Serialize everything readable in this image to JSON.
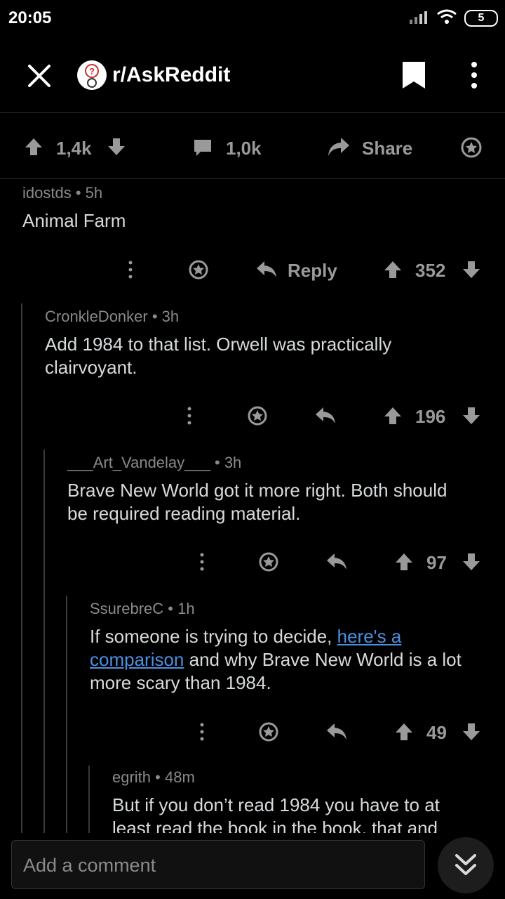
{
  "status": {
    "time": "20:05",
    "battery": "5"
  },
  "header": {
    "subreddit": "r/AskReddit"
  },
  "post_actions": {
    "upvotes": "1,4k",
    "comments": "1,0k",
    "share": "Share"
  },
  "comments": [
    {
      "author": "idostds",
      "age": "5h",
      "body": "Animal Farm",
      "reply": "Reply",
      "score": "352"
    },
    {
      "author": "CronkleDonker",
      "age": "3h",
      "body_lines": [
        "Add 1984 to that list. Orwell was practically",
        "clairvoyant."
      ],
      "score": "196"
    },
    {
      "author": "___Art_Vandelay___",
      "age": "3h",
      "body_lines": [
        "Brave New World got it more right. Both should",
        "be required reading material."
      ],
      "score": "97"
    },
    {
      "author": "SsurebreC",
      "age": "1h",
      "body_prefix": "If someone is trying to decide, ",
      "link_part1": "here's a",
      "link_part2": "comparison",
      "body_suffix": " and why Brave New World is a lot",
      "body_line3": "more scary than 1984.",
      "score": "49"
    },
    {
      "author": "egrith",
      "age": "48m",
      "body_lines": [
        "But if you don’t read 1984 you have to at",
        "least read the book in the book, that and"
      ]
    }
  ],
  "composer": {
    "placeholder": "Add a comment"
  },
  "icons": {
    "close": "close-icon",
    "avatar": "subreddit-avatar-icon",
    "bookmark": "bookmark-icon",
    "more": "more-vertical-icon",
    "upvote": "upvote-arrow-icon",
    "downvote": "downvote-arrow-icon",
    "comment": "comment-bubble-icon",
    "share": "share-arrow-icon",
    "award": "award-icon",
    "reply": "reply-arrow-icon",
    "scroll": "double-chevron-down-icon"
  },
  "colors": {
    "background": "#000000",
    "text": "#d7dadc",
    "muted": "#8a8a8a",
    "link": "#4a90e2"
  }
}
